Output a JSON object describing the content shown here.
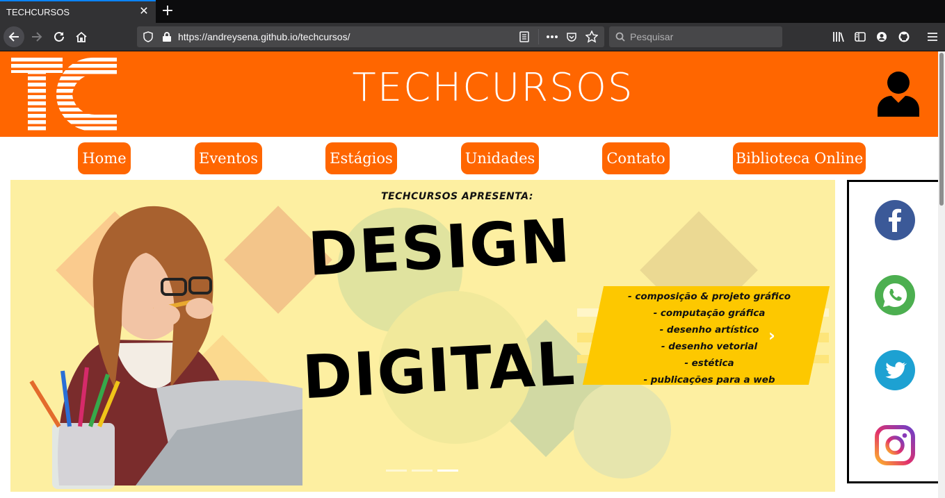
{
  "browser": {
    "tab_title": "TECHCURSOS",
    "tab_close_glyph": "✕",
    "new_tab_glyph": "+",
    "url": "https://andreysena.github.io/techcursos/",
    "search_placeholder": "Pesquisar",
    "toolbar_icons": [
      "back-icon",
      "forward-icon",
      "reload-icon",
      "home-icon",
      "shield-icon",
      "lock-icon",
      "reader-icon",
      "more-icon",
      "pocket-icon",
      "star-icon",
      "library-icon",
      "sidebar-icon",
      "account-icon",
      "github-icon",
      "menu-icon"
    ]
  },
  "header": {
    "logo_text": "TC",
    "brand": "TECHCURSOS",
    "bg_color": "#ff6600"
  },
  "menu": {
    "items": [
      {
        "label": "Home"
      },
      {
        "label": "Eventos"
      },
      {
        "label": "Estágios"
      },
      {
        "label": "Unidades"
      },
      {
        "label": "Contato"
      },
      {
        "label": "Biblioteca Online"
      }
    ]
  },
  "banner": {
    "presents": "TECHCURSOS APRESENTA:",
    "word1": "DESIGN",
    "word2": "DIGITAL",
    "topics": [
      "- composição & projeto gráfico",
      "- computação gráfica",
      "- desenho artístico",
      "- desenho vetorial",
      "- estética",
      "- publicações para a web"
    ],
    "next_glyph": "›",
    "slides": 3,
    "active_slide": 3
  },
  "social": {
    "items": [
      "facebook-icon",
      "whatsapp-icon",
      "twitter-icon",
      "instagram-icon"
    ]
  }
}
